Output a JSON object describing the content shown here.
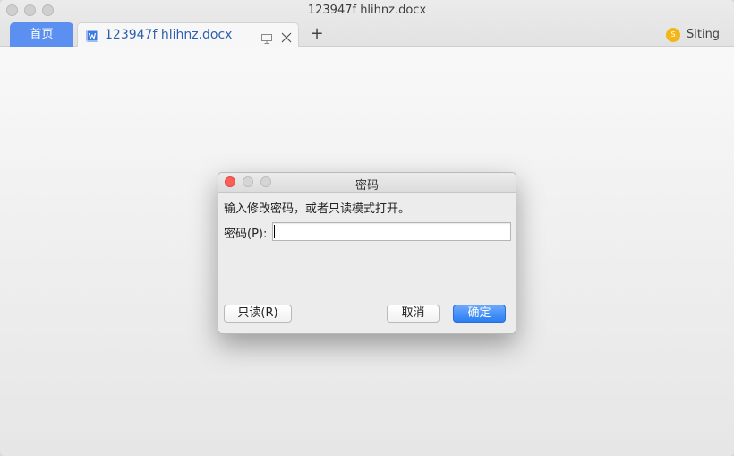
{
  "window": {
    "title": "123947f hlihnz.docx"
  },
  "tabs": {
    "home_label": "首页",
    "doc_label": "123947f hlihnz.docx",
    "new_tab": "+"
  },
  "user": {
    "badge": "S",
    "name": "Siting",
    "badge_color": "#f2b619"
  },
  "dialog": {
    "title": "密码",
    "message": "输入修改密码，或者只读模式打开。",
    "password_label": "密码(P):",
    "password_value": "",
    "readonly_button": "只读(R)",
    "cancel_button": "取消",
    "ok_button": "确定"
  },
  "colors": {
    "accent": "#5b8ff0",
    "ok_button": "#2a7ef5",
    "close_dot": "#fc5f57"
  },
  "icons": {
    "doc": "word-doc-icon",
    "monitor": "monitor-icon",
    "close": "close-icon"
  }
}
